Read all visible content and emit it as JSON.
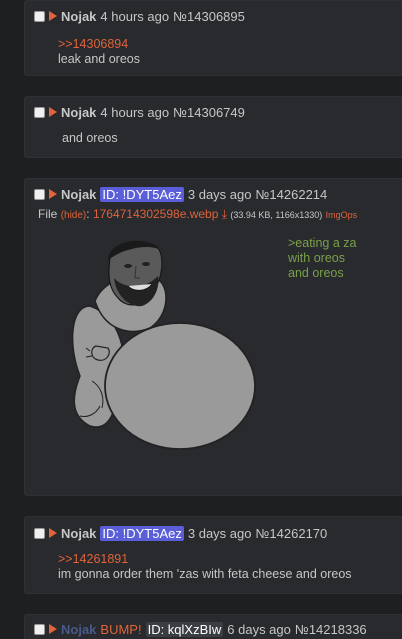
{
  "posts": [
    {
      "name": "Nojak",
      "time": "4 hours ago",
      "number": "№14306895",
      "quote": ">>14306894",
      "text": "leak and oreos"
    },
    {
      "name": "Nojak",
      "time": "4 hours ago",
      "number": "№14306749",
      "text": "and oreos"
    },
    {
      "name": "Nojak",
      "id": "ID: !DYT5Aez",
      "time": "3 days ago",
      "number": "№14262214",
      "file": {
        "label": "File",
        "hide": "(hide)",
        "filename": "1764714302598e.webp",
        "meta": "(33.94 KB, 1166x1330)",
        "imgops": "ImgOps"
      },
      "green": [
        ">eating a za",
        "with oreos",
        "and oreos"
      ]
    },
    {
      "name": "Nojak",
      "id": "ID: !DYT5Aez",
      "time": "3 days ago",
      "number": "№14262170",
      "quote": ">>14261891",
      "text": "im gonna order them 'zas with feta cheese and oreos"
    },
    {
      "name": "Nojak",
      "bump": "BUMP!",
      "id": "ID: kqlXzBIw",
      "time": "6 days ago",
      "number": "№14218336"
    }
  ],
  "colors": {
    "background": "#1d1f21",
    "post_bg": "#282a2e",
    "quote_link": "#e0633a",
    "greentext": "#7aa04a",
    "id_badge": "#5a5ed8"
  },
  "icons": [
    "select-checkbox",
    "post-menu-arrow-icon",
    "download-icon"
  ]
}
